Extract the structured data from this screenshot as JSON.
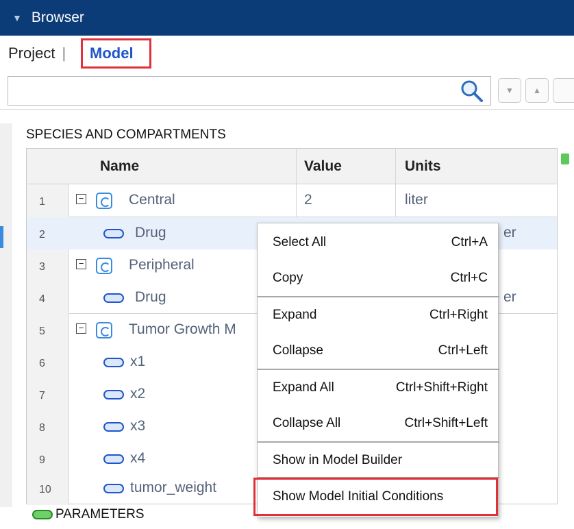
{
  "panel": {
    "title": "Browser"
  },
  "tabs": {
    "project": "Project",
    "separator": "|",
    "model": "Model"
  },
  "search": {
    "value": "",
    "placeholder": ""
  },
  "species": {
    "section_title": "SPECIES AND COMPARTMENTS",
    "columns": {
      "name": "Name",
      "value": "Value",
      "units": "Units"
    },
    "rows": [
      {
        "num": "1",
        "name": "Central",
        "value": "2",
        "units": "liter"
      },
      {
        "num": "2",
        "name": "Drug",
        "value": "",
        "units": "er"
      },
      {
        "num": "3",
        "name": "Peripheral",
        "value": "",
        "units": ""
      },
      {
        "num": "4",
        "name": "Drug",
        "value": "",
        "units": "er"
      },
      {
        "num": "5",
        "name": "Tumor Growth M",
        "value": "",
        "units": ""
      },
      {
        "num": "6",
        "name": "x1",
        "value": "",
        "units": ""
      },
      {
        "num": "7",
        "name": "x2",
        "value": "",
        "units": ""
      },
      {
        "num": "8",
        "name": "x3",
        "value": "",
        "units": ""
      },
      {
        "num": "9",
        "name": "x4",
        "value": "",
        "units": ""
      },
      {
        "num": "10",
        "name": "tumor_weight",
        "value": "",
        "units": ""
      }
    ]
  },
  "parameters": {
    "section_title": "PARAMETERS"
  },
  "context_menu": {
    "items": [
      {
        "label": "Select All",
        "shortcut": "Ctrl+A"
      },
      {
        "label": "Copy",
        "shortcut": "Ctrl+C"
      },
      {
        "label": "Expand",
        "shortcut": "Ctrl+Right"
      },
      {
        "label": "Collapse",
        "shortcut": "Ctrl+Left"
      },
      {
        "label": "Expand All",
        "shortcut": "Ctrl+Shift+Right"
      },
      {
        "label": "Collapse All",
        "shortcut": "Ctrl+Shift+Left"
      },
      {
        "label": "Show in Model Builder",
        "shortcut": ""
      },
      {
        "label": "Show Model Initial Conditions",
        "shortcut": ""
      }
    ]
  },
  "colors": {
    "titlebar": "#0c3c78",
    "highlight": "#e0303a",
    "accent": "#1f55c9"
  }
}
